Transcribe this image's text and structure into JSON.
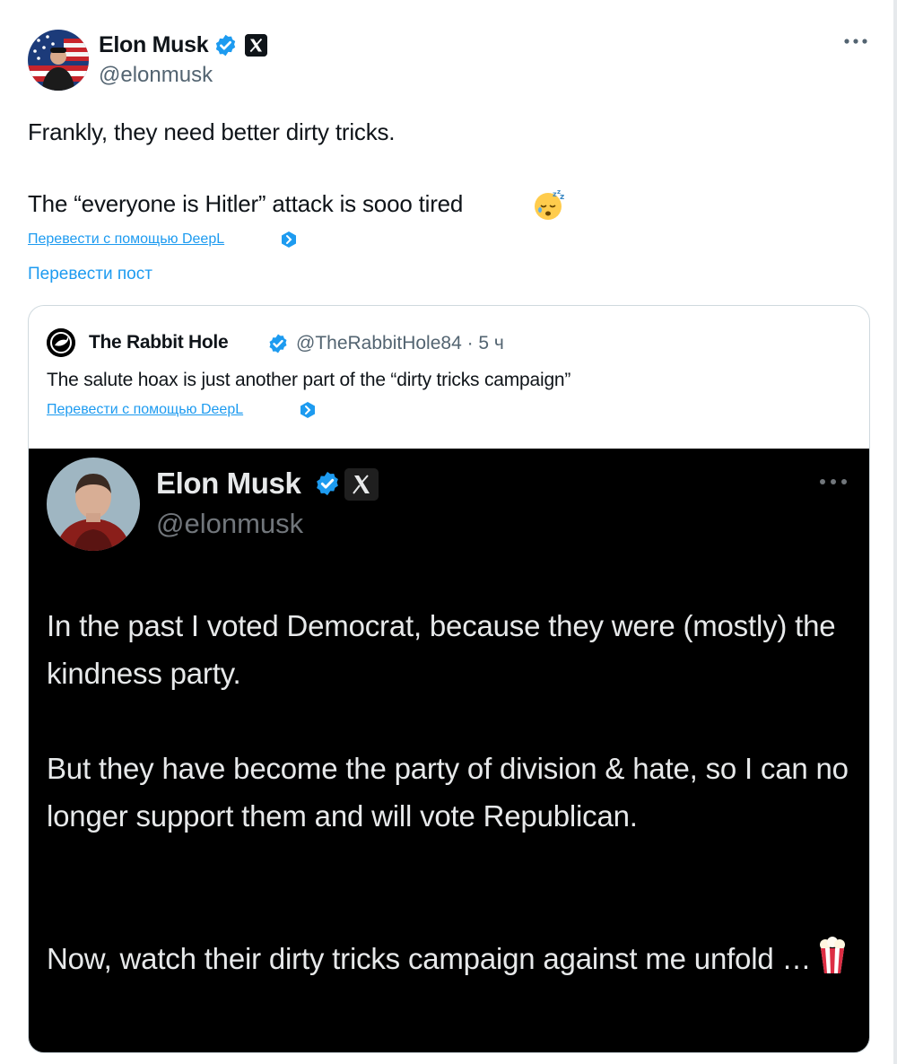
{
  "tweet": {
    "author_name": "Elon Musk",
    "author_handle": "@elonmusk",
    "body_line_1": "Frankly, they need better dirty tricks.",
    "body_line_2": "The “everyone is Hitler” attack is sooo tired",
    "emoji": "sleeping-face-emoji",
    "deepl_link": "Перевести с помощью DeepL",
    "translate_post": "Перевести пост",
    "accent_color": "#1d9bf0"
  },
  "quote": {
    "author_name": "The Rabbit Hole",
    "author_handle": "@TheRabbitHole84 · 5 ч",
    "text": "The salute hoax is just another part of the “dirty tricks campaign”",
    "deepl_link": "Перевести с помощью DeepL",
    "image": {
      "author_name": "Elon Musk",
      "author_handle": "@elonmusk",
      "paragraph_1": "In the past I voted Democrat, because they were (mostly) the kindness party.",
      "paragraph_2": "But they have become the party of division & hate, so I can no longer support them and will vote Republican.",
      "paragraph_3": "Now, watch their dirty tricks campaign against me unfold …",
      "emoji": "popcorn-emoji"
    }
  }
}
